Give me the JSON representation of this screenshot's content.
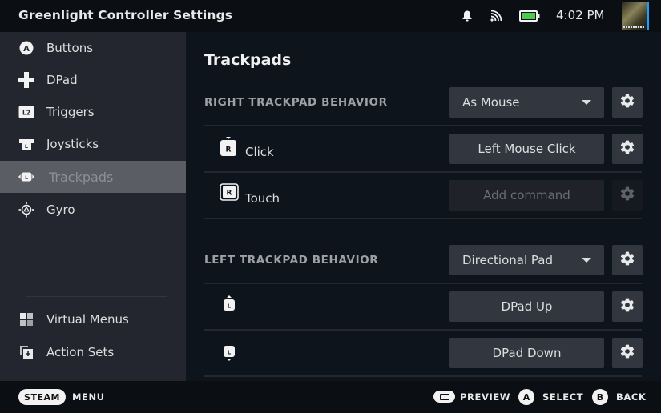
{
  "header": {
    "title": "Greenlight Controller Settings",
    "time": "4:02 PM",
    "icons": {
      "notifications": "bell-icon",
      "connection": "cast-icon",
      "battery": "battery-icon"
    },
    "battery_color": "#4ec94e",
    "avatar_accent": "#1a9fff"
  },
  "sidebar": {
    "items": [
      {
        "label": "Buttons",
        "icon": "a-button-icon",
        "active": false
      },
      {
        "label": "DPad",
        "icon": "dpad-icon",
        "active": false
      },
      {
        "label": "Triggers",
        "icon": "l2-trigger-icon",
        "active": false
      },
      {
        "label": "Joysticks",
        "icon": "joystick-icon",
        "active": false
      },
      {
        "label": "Trackpads",
        "icon": "trackpad-icon",
        "active": true
      },
      {
        "label": "Gyro",
        "icon": "gyro-icon",
        "active": false
      }
    ],
    "bottom_items": [
      {
        "label": "Virtual Menus",
        "icon": "virtual-menus-icon"
      },
      {
        "label": "Action Sets",
        "icon": "action-sets-icon"
      }
    ]
  },
  "main": {
    "title": "Trackpads",
    "sections": [
      {
        "label": "RIGHT TRACKPAD BEHAVIOR",
        "mode": "As Mouse",
        "rows": [
          {
            "label": "Click",
            "icon": "right-trackpad-click-icon",
            "command": "Left Mouse Click",
            "disabled": false
          },
          {
            "label": "Touch",
            "icon": "right-trackpad-touch-icon",
            "command": "Add command",
            "disabled": true
          }
        ]
      },
      {
        "label": "LEFT TRACKPAD BEHAVIOR",
        "mode": "Directional Pad",
        "rows": [
          {
            "label": "",
            "icon": "left-trackpad-up-icon",
            "command": "DPad Up",
            "disabled": false
          },
          {
            "label": "",
            "icon": "left-trackpad-down-icon",
            "command": "DPad Down",
            "disabled": false
          }
        ]
      }
    ]
  },
  "footer": {
    "steam_label": "STEAM",
    "menu_label": "MENU",
    "preview_label": "PREVIEW",
    "select_glyph": "A",
    "select_label": "SELECT",
    "back_glyph": "B",
    "back_label": "BACK"
  }
}
